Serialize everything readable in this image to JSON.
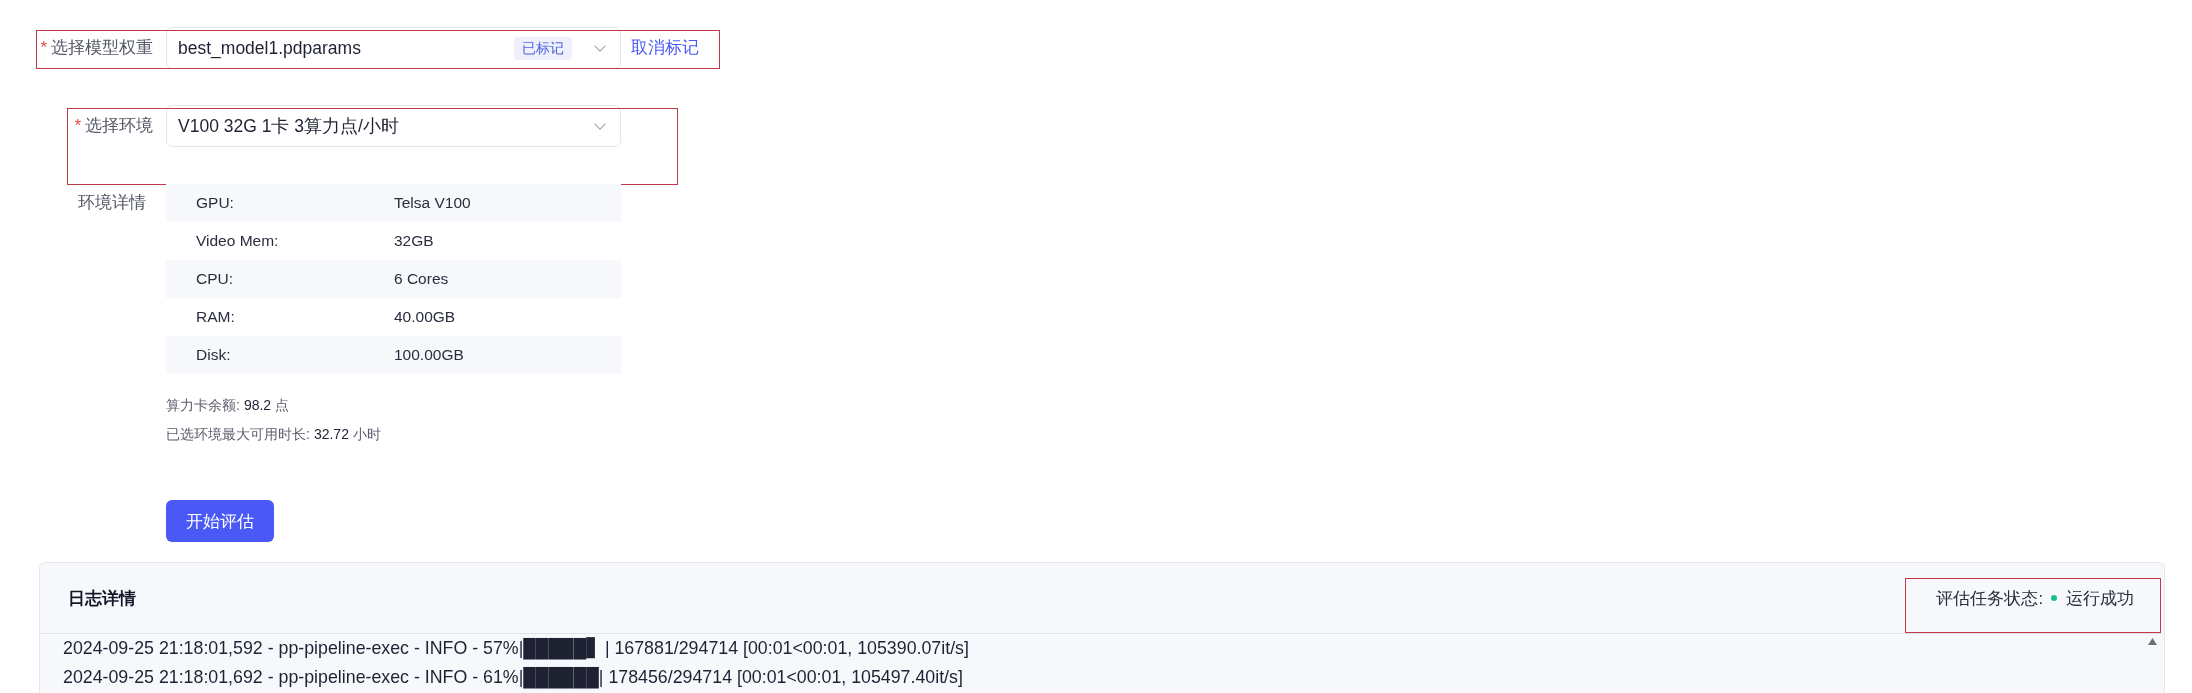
{
  "form": {
    "model_weight": {
      "marker": "*",
      "label": "选择模型权重",
      "value": "best_model1.pdparams",
      "tag": "已标记",
      "link": "取消标记",
      "highlighted": true
    },
    "environment": {
      "marker": "*",
      "label": "选择环境",
      "value": "V100 32G 1卡 3算力点/小时",
      "highlighted": true
    },
    "environment_details": {
      "label": "环境详情",
      "rows": [
        {
          "key": "GPU:",
          "value": "Telsa V100"
        },
        {
          "key": "Video Mem:",
          "value": "32GB"
        },
        {
          "key": "CPU:",
          "value": "6 Cores"
        },
        {
          "key": "RAM:",
          "value": "40.00GB"
        },
        {
          "key": "Disk:",
          "value": "100.00GB"
        }
      ]
    },
    "info_lines": [
      {
        "label": "算力卡余额:",
        "value": "98.2",
        "unit": "点"
      },
      {
        "label": "已选环境最大可用时长:",
        "value": "32.72",
        "unit": "小时"
      }
    ],
    "submit_button": "开始评估"
  },
  "log_panel": {
    "title": "日志详情",
    "status": {
      "label": "评估任务状态:",
      "text": "运行成功",
      "color": "#18c08f",
      "highlighted": true
    },
    "lines": [
      "2024-09-25 21:18:01,592 - pp-pipeline-exec - INFO - 57%|█████▋ | 167881/294714 [00:01<00:01, 105390.07it/s]",
      "2024-09-25 21:18:01,692 - pp-pipeline-exec - INFO - 61%|██████| 178456/294714 [00:01<00:01, 105497.40it/s]"
    ]
  }
}
